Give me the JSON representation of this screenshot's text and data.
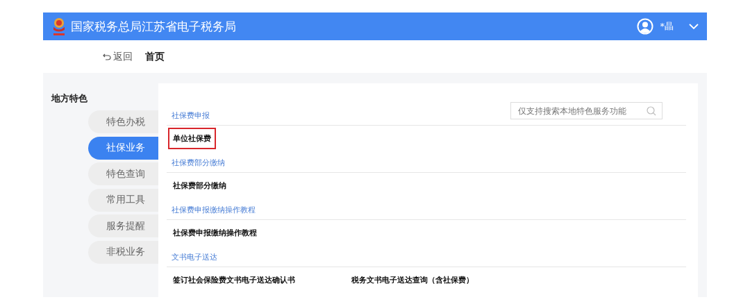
{
  "header": {
    "title": "国家税务总局江苏省电子税务局",
    "user": "*晶"
  },
  "breadcrumb": {
    "back": "返回",
    "current": "首页"
  },
  "sidebar": {
    "title": "地方特色",
    "items": [
      {
        "label": "特色办税",
        "selected": false
      },
      {
        "label": "社保业务",
        "selected": true
      },
      {
        "label": "特色查询",
        "selected": false
      },
      {
        "label": "常用工具",
        "selected": false
      },
      {
        "label": "服务提醒",
        "selected": false
      },
      {
        "label": "非税业务",
        "selected": false
      }
    ]
  },
  "search": {
    "placeholder": "仅支持搜索本地特色服务功能"
  },
  "sections": [
    {
      "title": "社保费申报",
      "items": [
        {
          "label": "单位社保费",
          "highlighted": true
        }
      ]
    },
    {
      "title": "社保费部分缴纳",
      "items": [
        {
          "label": "社保费部分缴纳",
          "highlighted": false
        }
      ]
    },
    {
      "title": "社保费申报缴纳操作教程",
      "items": [
        {
          "label": "社保费申报缴纳操作教程",
          "highlighted": false
        }
      ]
    },
    {
      "title": "文书电子送达",
      "items": [
        {
          "label": "签订社会保险费文书电子送达确认书",
          "highlighted": false
        },
        {
          "label": "税务文书电子送达查询（含社保费）",
          "highlighted": false
        }
      ]
    }
  ]
}
